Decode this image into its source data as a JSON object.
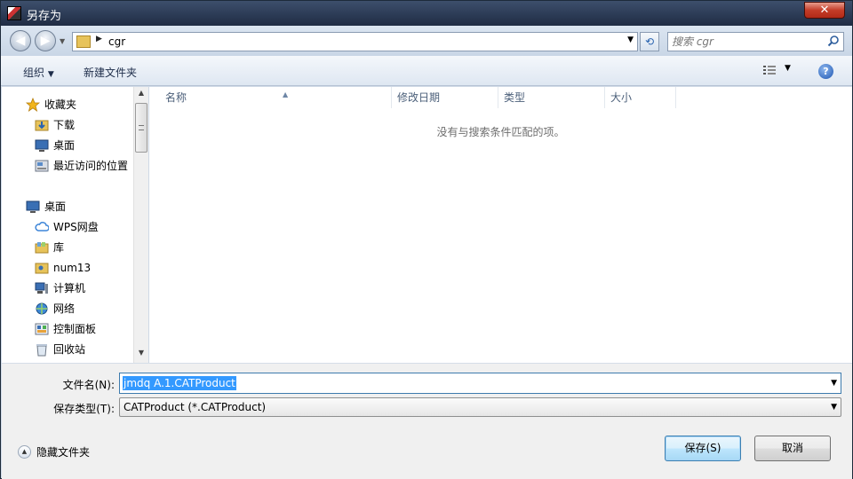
{
  "window": {
    "title": "另存为",
    "close_glyph": "✕"
  },
  "nav": {
    "back_glyph": "◀",
    "forward_glyph": "▶",
    "path": "cgr",
    "search_placeholder": "搜索 cgr"
  },
  "toolbar": {
    "organize": "组织",
    "new_folder": "新建文件夹",
    "help_glyph": "?"
  },
  "sidebar": {
    "items": [
      {
        "label": "收藏夹",
        "icon": "star-icon",
        "indent": false
      },
      {
        "label": "下载",
        "icon": "download-folder-icon",
        "indent": true
      },
      {
        "label": "桌面",
        "icon": "desktop-icon",
        "indent": true
      },
      {
        "label": "最近访问的位置",
        "icon": "recent-places-icon",
        "indent": true
      },
      {
        "label": "桌面",
        "icon": "desktop-icon",
        "indent": false
      },
      {
        "label": "WPS网盘",
        "icon": "cloud-icon",
        "indent": true
      },
      {
        "label": "库",
        "icon": "library-icon",
        "indent": true
      },
      {
        "label": "num13",
        "icon": "user-folder-icon",
        "indent": true
      },
      {
        "label": "计算机",
        "icon": "computer-icon",
        "indent": true
      },
      {
        "label": "网络",
        "icon": "network-icon",
        "indent": true
      },
      {
        "label": "控制面板",
        "icon": "control-panel-icon",
        "indent": true
      },
      {
        "label": "回收站",
        "icon": "recycle-bin-icon",
        "indent": true
      }
    ]
  },
  "columns": [
    "名称",
    "修改日期",
    "类型",
    "大小"
  ],
  "empty_message": "没有与搜索条件匹配的项。",
  "form": {
    "filename_label": "文件名(N):",
    "filename_value": "jmdq A.1.CATProduct",
    "filetype_label": "保存类型(T):",
    "filetype_value": "CATProduct (*.CATProduct)"
  },
  "footer": {
    "hide_folders": "隐藏文件夹",
    "save": "保存(S)",
    "cancel": "取消"
  },
  "colors": {
    "selection": "#3399ff",
    "titlebar": "#2b3a55",
    "close": "#c43c28"
  }
}
